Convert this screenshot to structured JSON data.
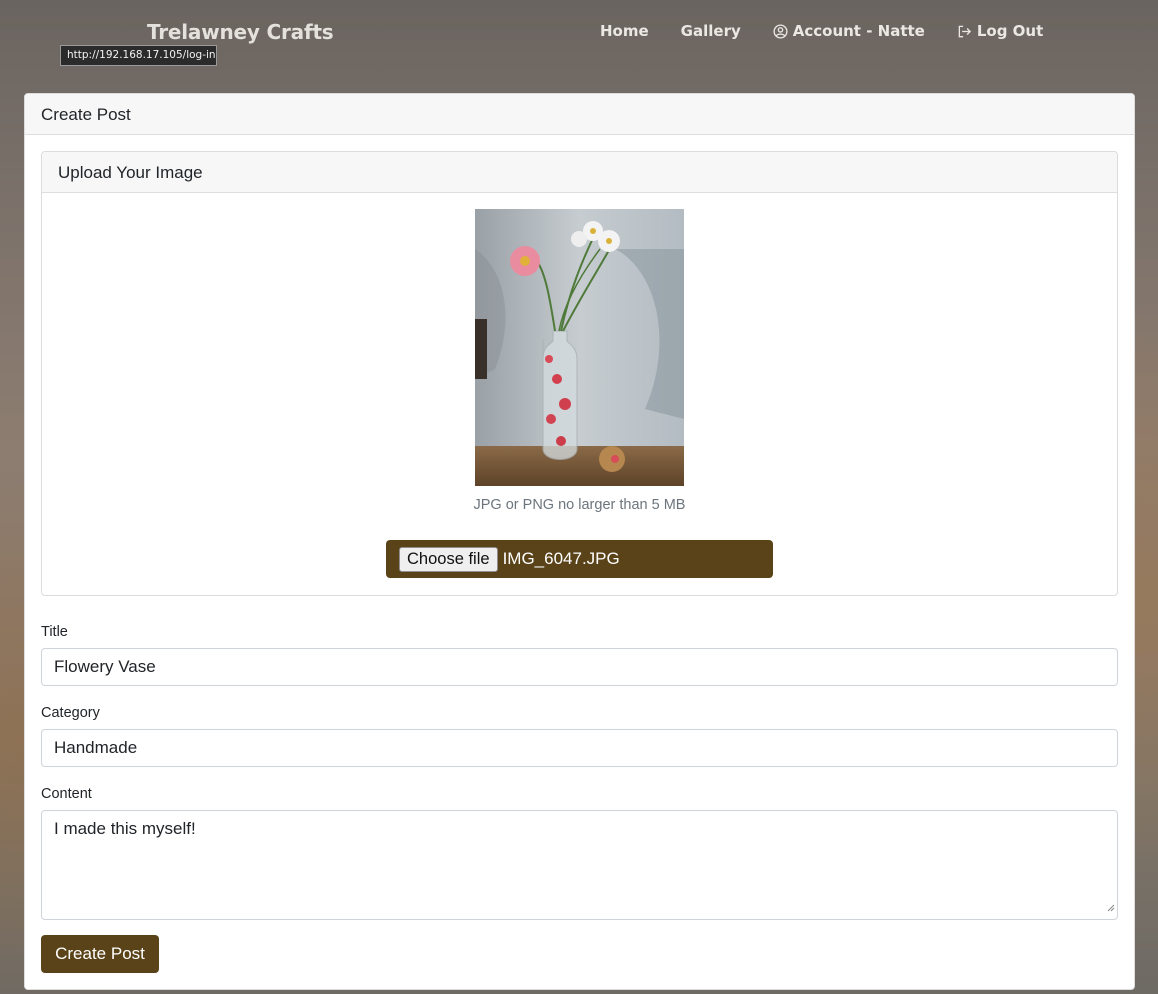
{
  "nav": {
    "brand": "Trelawney Crafts",
    "hover_url": "http://192.168.17.105/log-in",
    "links": [
      {
        "label": "Home",
        "icon": ""
      },
      {
        "label": "Gallery",
        "icon": ""
      },
      {
        "label": "Account - Natte",
        "icon": "user-circle-icon"
      },
      {
        "label": "Log Out",
        "icon": "sign-out-icon"
      }
    ]
  },
  "card": {
    "title": "Create Post"
  },
  "upload": {
    "title": "Upload Your Image",
    "hint": "JPG or PNG no larger than 5 MB",
    "choose_label": "Choose file",
    "file_name": "IMG_6047.JPG"
  },
  "form": {
    "title_label": "Title",
    "title_value": "Flowery Vase",
    "category_label": "Category",
    "category_value": "Handmade",
    "content_label": "Content",
    "content_value": "I made this myself!",
    "submit_label": "Create Post"
  },
  "colors": {
    "accent": "#5a4318",
    "header_bg": "#f7f7f7"
  }
}
